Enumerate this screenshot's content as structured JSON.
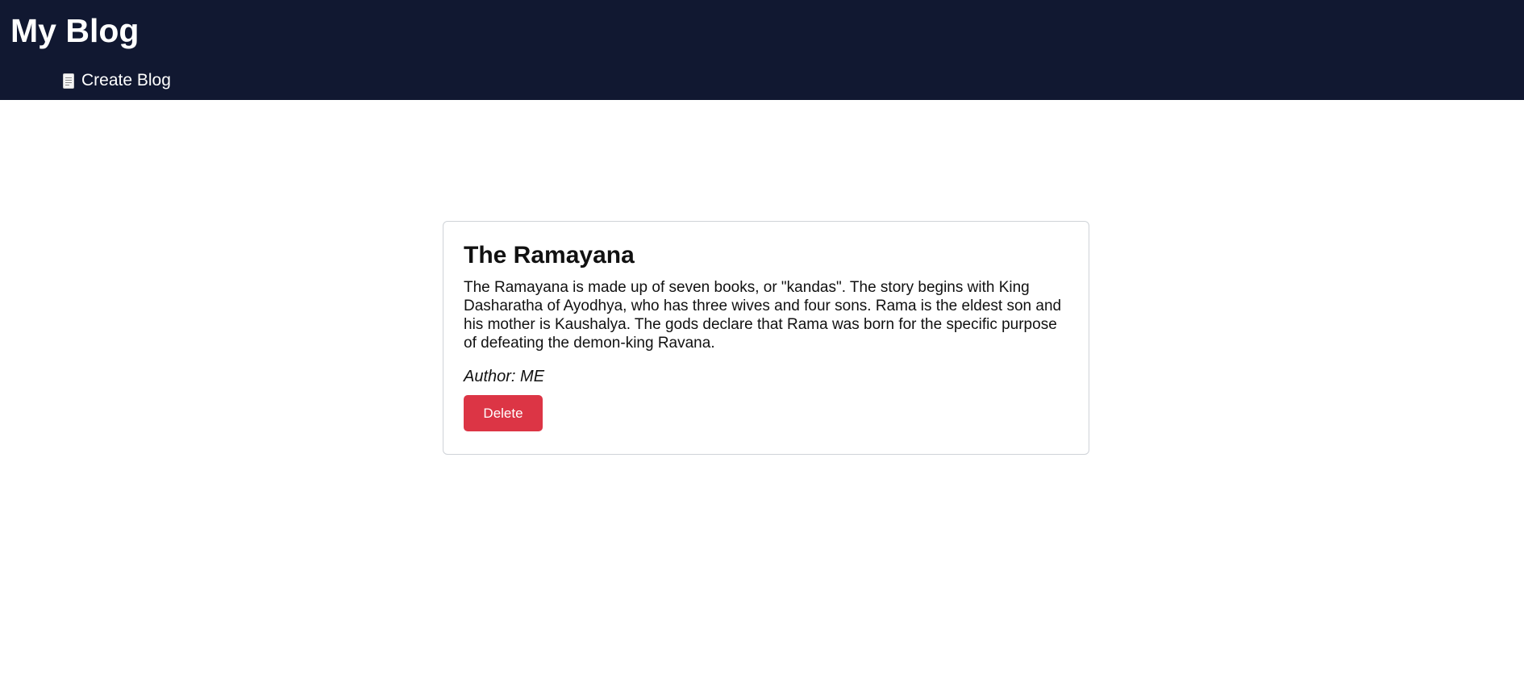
{
  "header": {
    "title": "My Blog",
    "nav": {
      "create_label": "Create Blog",
      "create_icon": "page-icon"
    }
  },
  "post": {
    "title": "The Ramayana",
    "body": "The Ramayana is made up of seven books, or \"kandas\". The story begins with King Dasharatha of Ayodhya, who has three wives and four sons. Rama is the eldest son and his mother is Kaushalya. The gods declare that Rama was born for the specific purpose of defeating the demon-king Ravana.",
    "author": "Author: ME",
    "delete_label": "Delete"
  },
  "colors": {
    "header_bg": "#111831",
    "delete_button": "#dc3545",
    "card_border": "#cfd3d8"
  }
}
